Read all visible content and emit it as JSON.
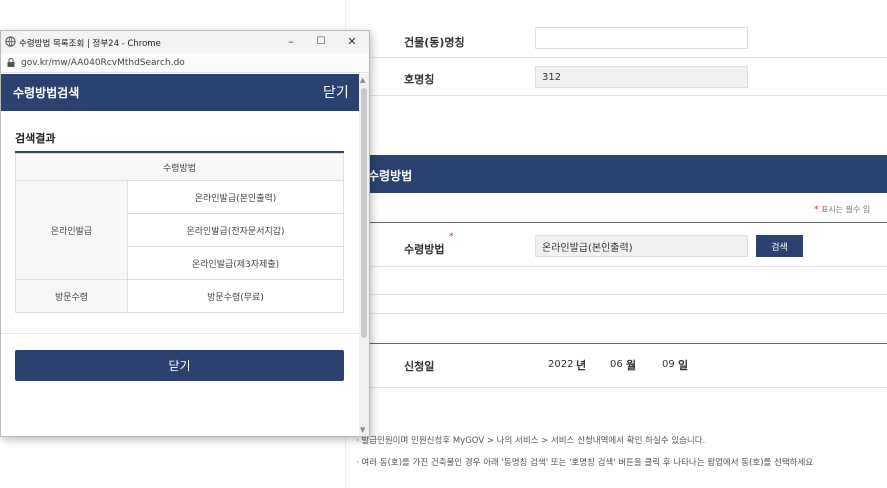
{
  "popup": {
    "window_title": "수령방법 목록조회 | 정부24 - Chrome",
    "url": "gov.kr/mw/AA040RcvMthdSearch.do",
    "header_title": "수령방법검색",
    "header_close": "닫기",
    "result_heading": "검색결과",
    "table": {
      "column_header": "수령방법",
      "groups": [
        {
          "category": "온라인발급",
          "options": [
            "온라인발급(본인출력)",
            "온라인발급(전자문서지갑)",
            "온라인발급(제3자제출)"
          ]
        },
        {
          "category": "방문수령",
          "options": [
            "방문수령(무료)"
          ]
        }
      ]
    },
    "close_button": "닫기",
    "controls": {
      "minimize": "–",
      "maximize": "☐",
      "close": "✕"
    }
  },
  "form": {
    "building_label": "건물(동)명칭",
    "building_value": "",
    "room_label": "호명칭",
    "room_value": "312",
    "section_title": "수령방법",
    "required_note": "표시는 필수 입",
    "method_label": "수령방법",
    "method_value": "온라인발급(본인출력)",
    "search_button": "검색",
    "date_label": "신청일",
    "date_year": "2022",
    "date_year_unit": "년",
    "date_month": "06",
    "date_month_unit": "월",
    "date_day": "09",
    "date_day_unit": "일"
  },
  "notes": [
    "발급민원이며 민원신청후 MyGOV > 나의 서비스 > 서비스 신청내역에서 확인 하실수 있습니다.",
    "여러 동(호)를 가진 건축물인 경우 아래 '동명칭 검색' 또는 '호명칭 검색' 버튼을 클릭 후 나타나는 팝업에서 동(호)를 선택하세요"
  ],
  "colors": {
    "accent": "#2b4270",
    "required": "#e0212e"
  }
}
